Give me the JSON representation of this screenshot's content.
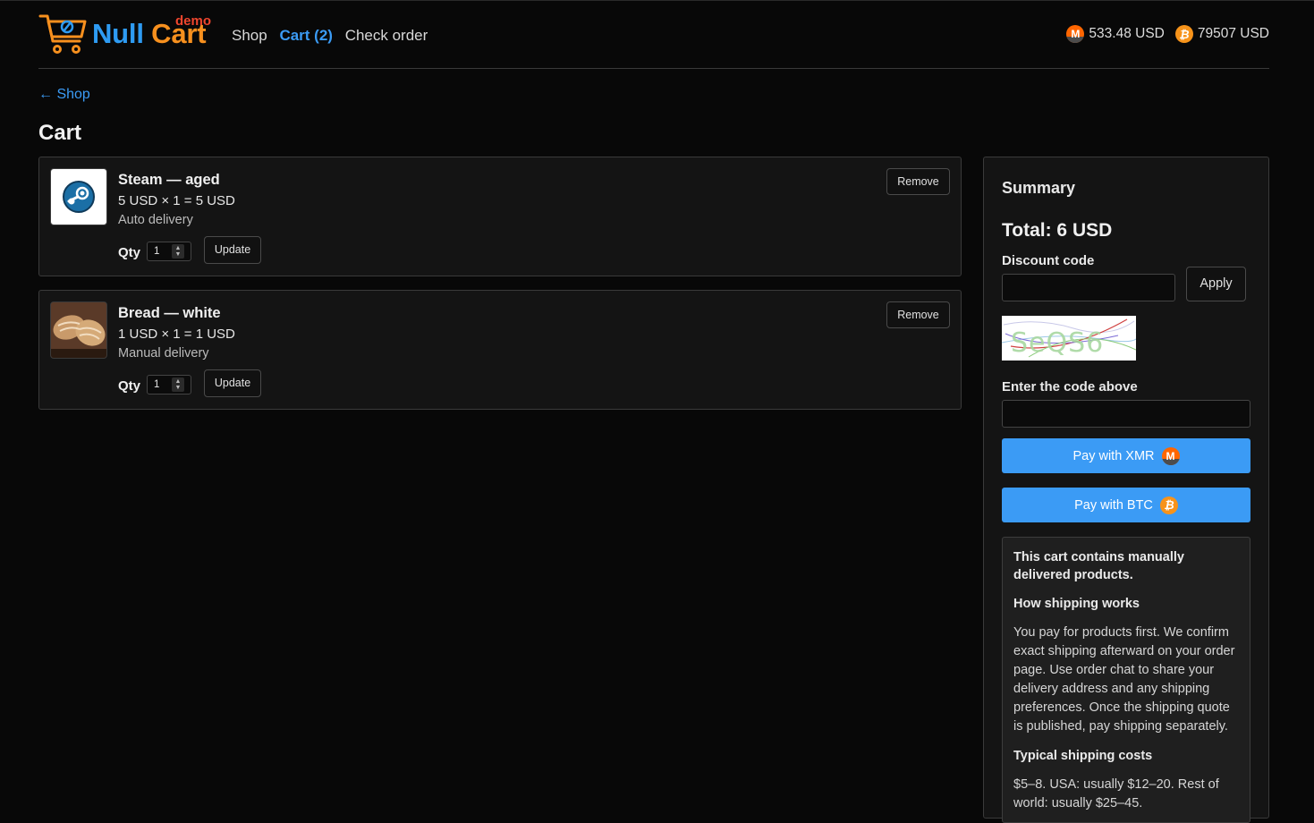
{
  "header": {
    "logo_word1": "Null",
    "logo_word2": "Cart",
    "logo_badge": "demo",
    "nav": [
      {
        "label": "Shop"
      },
      {
        "label": "Cart (2)"
      },
      {
        "label": "Check order"
      }
    ],
    "prices": [
      {
        "coin": "xmr",
        "icon": "monero-icon",
        "value": "533.48 USD"
      },
      {
        "coin": "btc",
        "icon": "bitcoin-icon",
        "value": "79507 USD"
      }
    ]
  },
  "back_link": "← Shop",
  "page_title": "Cart",
  "cart": {
    "items": [
      {
        "name": "Steam — aged",
        "calc": "5 USD × 1 = 5 USD",
        "delivery": "Auto delivery",
        "qty_label": "Qty",
        "qty": "1",
        "update_label": "Update",
        "remove_label": "Remove",
        "image": "steam-logo"
      },
      {
        "name": "Bread — white",
        "calc": "1 USD × 1 = 1 USD",
        "delivery": "Manual delivery",
        "qty_label": "Qty",
        "qty": "1",
        "update_label": "Update",
        "remove_label": "Remove",
        "image": "bread-photo"
      }
    ]
  },
  "summary": {
    "title": "Summary",
    "total": "Total: 6 USD",
    "discount_label": "Discount code",
    "discount_value": "",
    "apply_label": "Apply",
    "captcha_text": "SeQS6",
    "captcha_label": "Enter the code above",
    "captcha_value": "",
    "pay_xmr": "Pay with XMR",
    "pay_btc": "Pay with BTC",
    "notice": {
      "heading": "This cart contains manually delivered products.",
      "how_title": "How shipping works",
      "how_text": "You pay for products first. We confirm exact shipping afterward on your order page. Use order chat to share your delivery address and any shipping preferences. Once the shipping quote is published, pay shipping separately.",
      "costs_title": "Typical shipping costs",
      "costs_text": "$5–8. USA: usually $12–20. Rest of world: usually $25–45."
    }
  },
  "colors": {
    "background": "#080808",
    "accent": "#3b9bf5",
    "logo_blue": "#2e9bf2",
    "logo_orange": "#f7901e",
    "logo_demo": "#f0462e",
    "monero": "#ff6600",
    "bitcoin": "#f7931a"
  }
}
